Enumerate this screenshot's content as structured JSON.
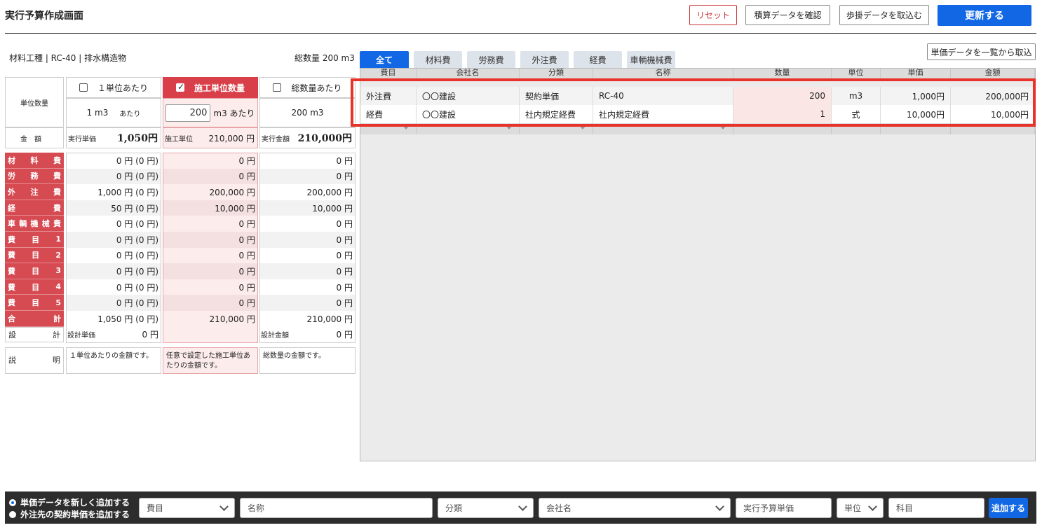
{
  "header": {
    "title": "実行予算作成画面",
    "reset_label": "リセット",
    "confirm_label": "積算データを確認",
    "import_label": "歩掛データを取込む",
    "update_label": "更新する"
  },
  "left": {
    "breadcrumb": "材料工種 | RC-40 | 排水構造物",
    "total_qty": "総数量 200 m3",
    "unit_qty_label": "単位数量",
    "amount_label": "金額",
    "col1": {
      "title": "１単位あたり",
      "qty": "1 m3",
      "per": "あたり",
      "amt_label": "実行単価",
      "amt": "1,050円"
    },
    "col2": {
      "title": "施工単位数量",
      "qty_value": "200",
      "qty_unit": "m3 あたり",
      "amt_label": "施工単位",
      "amt": "210,000 円"
    },
    "col3": {
      "title": "総数量あたり",
      "qty": "200 m3",
      "amt_label": "実行金額",
      "amt": "210,000円"
    },
    "rows": [
      {
        "label_chars": [
          "材",
          "料",
          "費"
        ],
        "v1": "0 円 (0 円)",
        "v2": "0 円",
        "v3": "0 円"
      },
      {
        "label_chars": [
          "労",
          "務",
          "費"
        ],
        "v1": "0 円 (0 円)",
        "v2": "0 円",
        "v3": "0 円"
      },
      {
        "label_chars": [
          "外",
          "注",
          "費"
        ],
        "v1": "1,000 円 (0 円)",
        "v2": "200,000 円",
        "v3": "200,000 円"
      },
      {
        "label_chars": [
          "経",
          "費"
        ],
        "v1": "50 円 (0 円)",
        "v2": "10,000 円",
        "v3": "10,000 円"
      },
      {
        "label_chars": [
          "車",
          "輌",
          "機",
          "械",
          "費"
        ],
        "v1": "0 円 (0 円)",
        "v2": "0 円",
        "v3": "0 円"
      },
      {
        "label_chars": [
          "費",
          "目",
          "1"
        ],
        "v1": "0 円 (0 円)",
        "v2": "0 円",
        "v3": "0 円"
      },
      {
        "label_chars": [
          "費",
          "目",
          "2"
        ],
        "v1": "0 円 (0 円)",
        "v2": "0 円",
        "v3": "0 円"
      },
      {
        "label_chars": [
          "費",
          "目",
          "3"
        ],
        "v1": "0 円 (0 円)",
        "v2": "0 円",
        "v3": "0 円"
      },
      {
        "label_chars": [
          "費",
          "目",
          "4"
        ],
        "v1": "0 円 (0 円)",
        "v2": "0 円",
        "v3": "0 円"
      },
      {
        "label_chars": [
          "費",
          "目",
          "5"
        ],
        "v1": "0 円 (0 円)",
        "v2": "0 円",
        "v3": "0 円"
      },
      {
        "label_chars": [
          "合",
          "計"
        ],
        "v1": "1,050 円 (0 円)",
        "v2": "210,000 円",
        "v3": "210,000 円"
      }
    ],
    "design_row": {
      "label_chars": [
        "設",
        "計"
      ],
      "c1_label": "設計単価",
      "c1_value": "0 円",
      "c3_label": "設計金額",
      "c3_value": "0 円"
    },
    "desc": {
      "label_chars": [
        "説",
        "明"
      ],
      "d1": "１単位あたりの金額です。",
      "d2": "任意で設定した施工単位あたりの金額です。",
      "d3": "総数量の金額です。"
    }
  },
  "right": {
    "tabs": [
      "全て",
      "材料費",
      "労務費",
      "外注費",
      "経費",
      "車輌機械費"
    ],
    "unit_list_btn": "単価データを一覧から取込",
    "columns": [
      "費目",
      "会社名",
      "分類",
      "名称",
      "数量",
      "単位",
      "単価",
      "金額"
    ],
    "rows": [
      {
        "himoku": "外注費",
        "company": "〇〇建設",
        "category": "契約単価",
        "name": "RC-40",
        "qty": "200",
        "unit": "m3",
        "price": "1,000円",
        "amount": "200,000円"
      },
      {
        "himoku": "経費",
        "company": "〇〇建設",
        "category": "社内規定経費",
        "name": "社内規定経費",
        "qty": "1",
        "unit": "式",
        "price": "10,000円",
        "amount": "10,000円"
      }
    ]
  },
  "bottom": {
    "radio1": "単価データを新しく追加する",
    "radio2": "外注先の契約単価を追加する",
    "fields": {
      "himoku": "費目",
      "name": "名称",
      "category": "分類",
      "company": "会社名",
      "budget_price": "実行予算単価",
      "unit": "単位",
      "kamoku": "科目"
    },
    "add_label": "追加する"
  },
  "colors": {
    "accent": "#1268e4",
    "danger": "#d83f49",
    "highlight": "#e8322a"
  }
}
